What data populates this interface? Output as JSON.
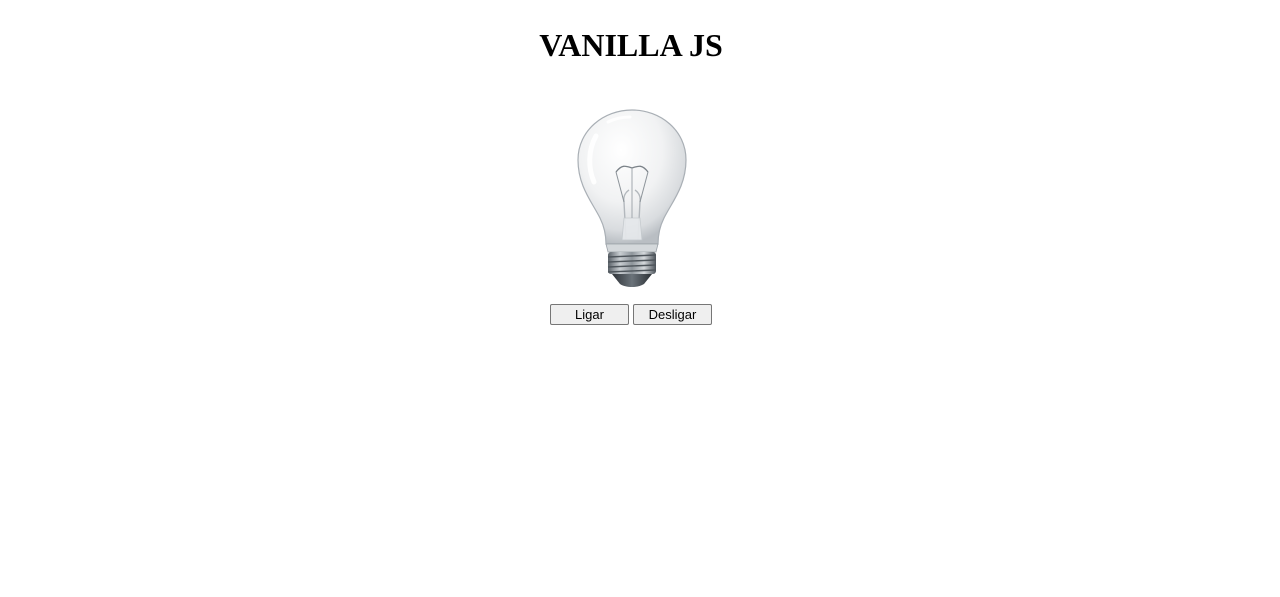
{
  "page": {
    "title": "VANILLA JS"
  },
  "bulb": {
    "icon": "lightbulb-off-icon",
    "state": "off"
  },
  "controls": {
    "on_label": "Ligar",
    "off_label": "Desligar"
  }
}
